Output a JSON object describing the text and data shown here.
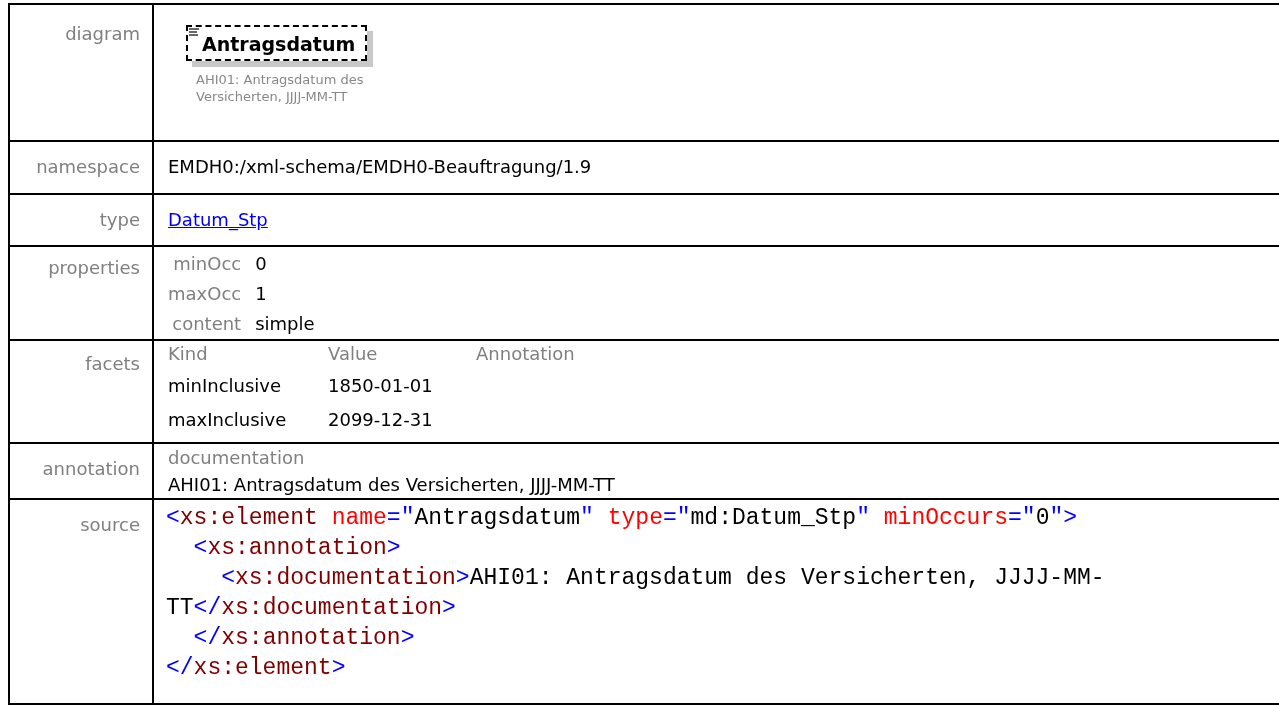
{
  "diagram": {
    "label": "diagram",
    "element": "Antragsdatum",
    "caption": "AHI01: Antragsdatum des Versicherten, JJJJ-MM-TT"
  },
  "namespace": {
    "label": "namespace",
    "value": "EMDH0:/xml-schema/EMDH0-Beauftragung/1.9"
  },
  "type": {
    "label": "type",
    "link": "Datum_Stp"
  },
  "properties": {
    "label": "properties",
    "items": [
      {
        "name": "minOcc",
        "value": "0"
      },
      {
        "name": "maxOcc",
        "value": "1"
      },
      {
        "name": "content",
        "value": "simple"
      }
    ]
  },
  "facets": {
    "label": "facets",
    "columns": [
      "Kind",
      "Value",
      "Annotation"
    ],
    "rows": [
      {
        "facet": "minInclusive",
        "value": "1850-01-01"
      },
      {
        "facet": "maxInclusive",
        "value": "2099-12-31"
      }
    ]
  },
  "annotation": {
    "label": "annotation",
    "heading": "documentation",
    "text": "AHI01: Antragsdatum des Versicherten, JJJJ-MM-TT"
  },
  "source": {
    "label": "source",
    "lines": [
      [
        {
          "kind": "punct",
          "text": "<"
        },
        {
          "kind": "tag",
          "text": "xs:element"
        },
        {
          "kind": "attr",
          "text": " name"
        },
        {
          "kind": "punct",
          "text": "=\""
        },
        {
          "kind": "text",
          "text": "Antragsdatum"
        },
        {
          "kind": "punct",
          "text": "\""
        },
        {
          "kind": "attr",
          "text": " type"
        },
        {
          "kind": "punct",
          "text": "=\""
        },
        {
          "kind": "text",
          "text": "md:Datum_Stp"
        },
        {
          "kind": "punct",
          "text": "\""
        },
        {
          "kind": "attr",
          "text": " minOccurs"
        },
        {
          "kind": "punct",
          "text": "=\""
        },
        {
          "kind": "text",
          "text": "0"
        },
        {
          "kind": "punct",
          "text": "\">"
        }
      ],
      [
        {
          "kind": "punct",
          "text": "  <"
        },
        {
          "kind": "tag",
          "text": "xs:annotation"
        },
        {
          "kind": "punct",
          "text": ">"
        }
      ],
      [
        {
          "kind": "punct",
          "text": "    <"
        },
        {
          "kind": "tag",
          "text": "xs:documentation"
        },
        {
          "kind": "punct",
          "text": ">"
        },
        {
          "kind": "text",
          "text": "AHI01: Antragsdatum des Versicherten, JJJJ-MM-"
        }
      ],
      [
        {
          "kind": "text",
          "text": "TT"
        },
        {
          "kind": "punct",
          "text": "</"
        },
        {
          "kind": "tag",
          "text": "xs:documentation"
        },
        {
          "kind": "punct",
          "text": ">"
        }
      ],
      [
        {
          "kind": "punct",
          "text": "  </"
        },
        {
          "kind": "tag",
          "text": "xs:annotation"
        },
        {
          "kind": "punct",
          "text": ">"
        }
      ],
      [
        {
          "kind": "punct",
          "text": "</"
        },
        {
          "kind": "tag",
          "text": "xs:element"
        },
        {
          "kind": "punct",
          "text": ">"
        }
      ]
    ]
  }
}
